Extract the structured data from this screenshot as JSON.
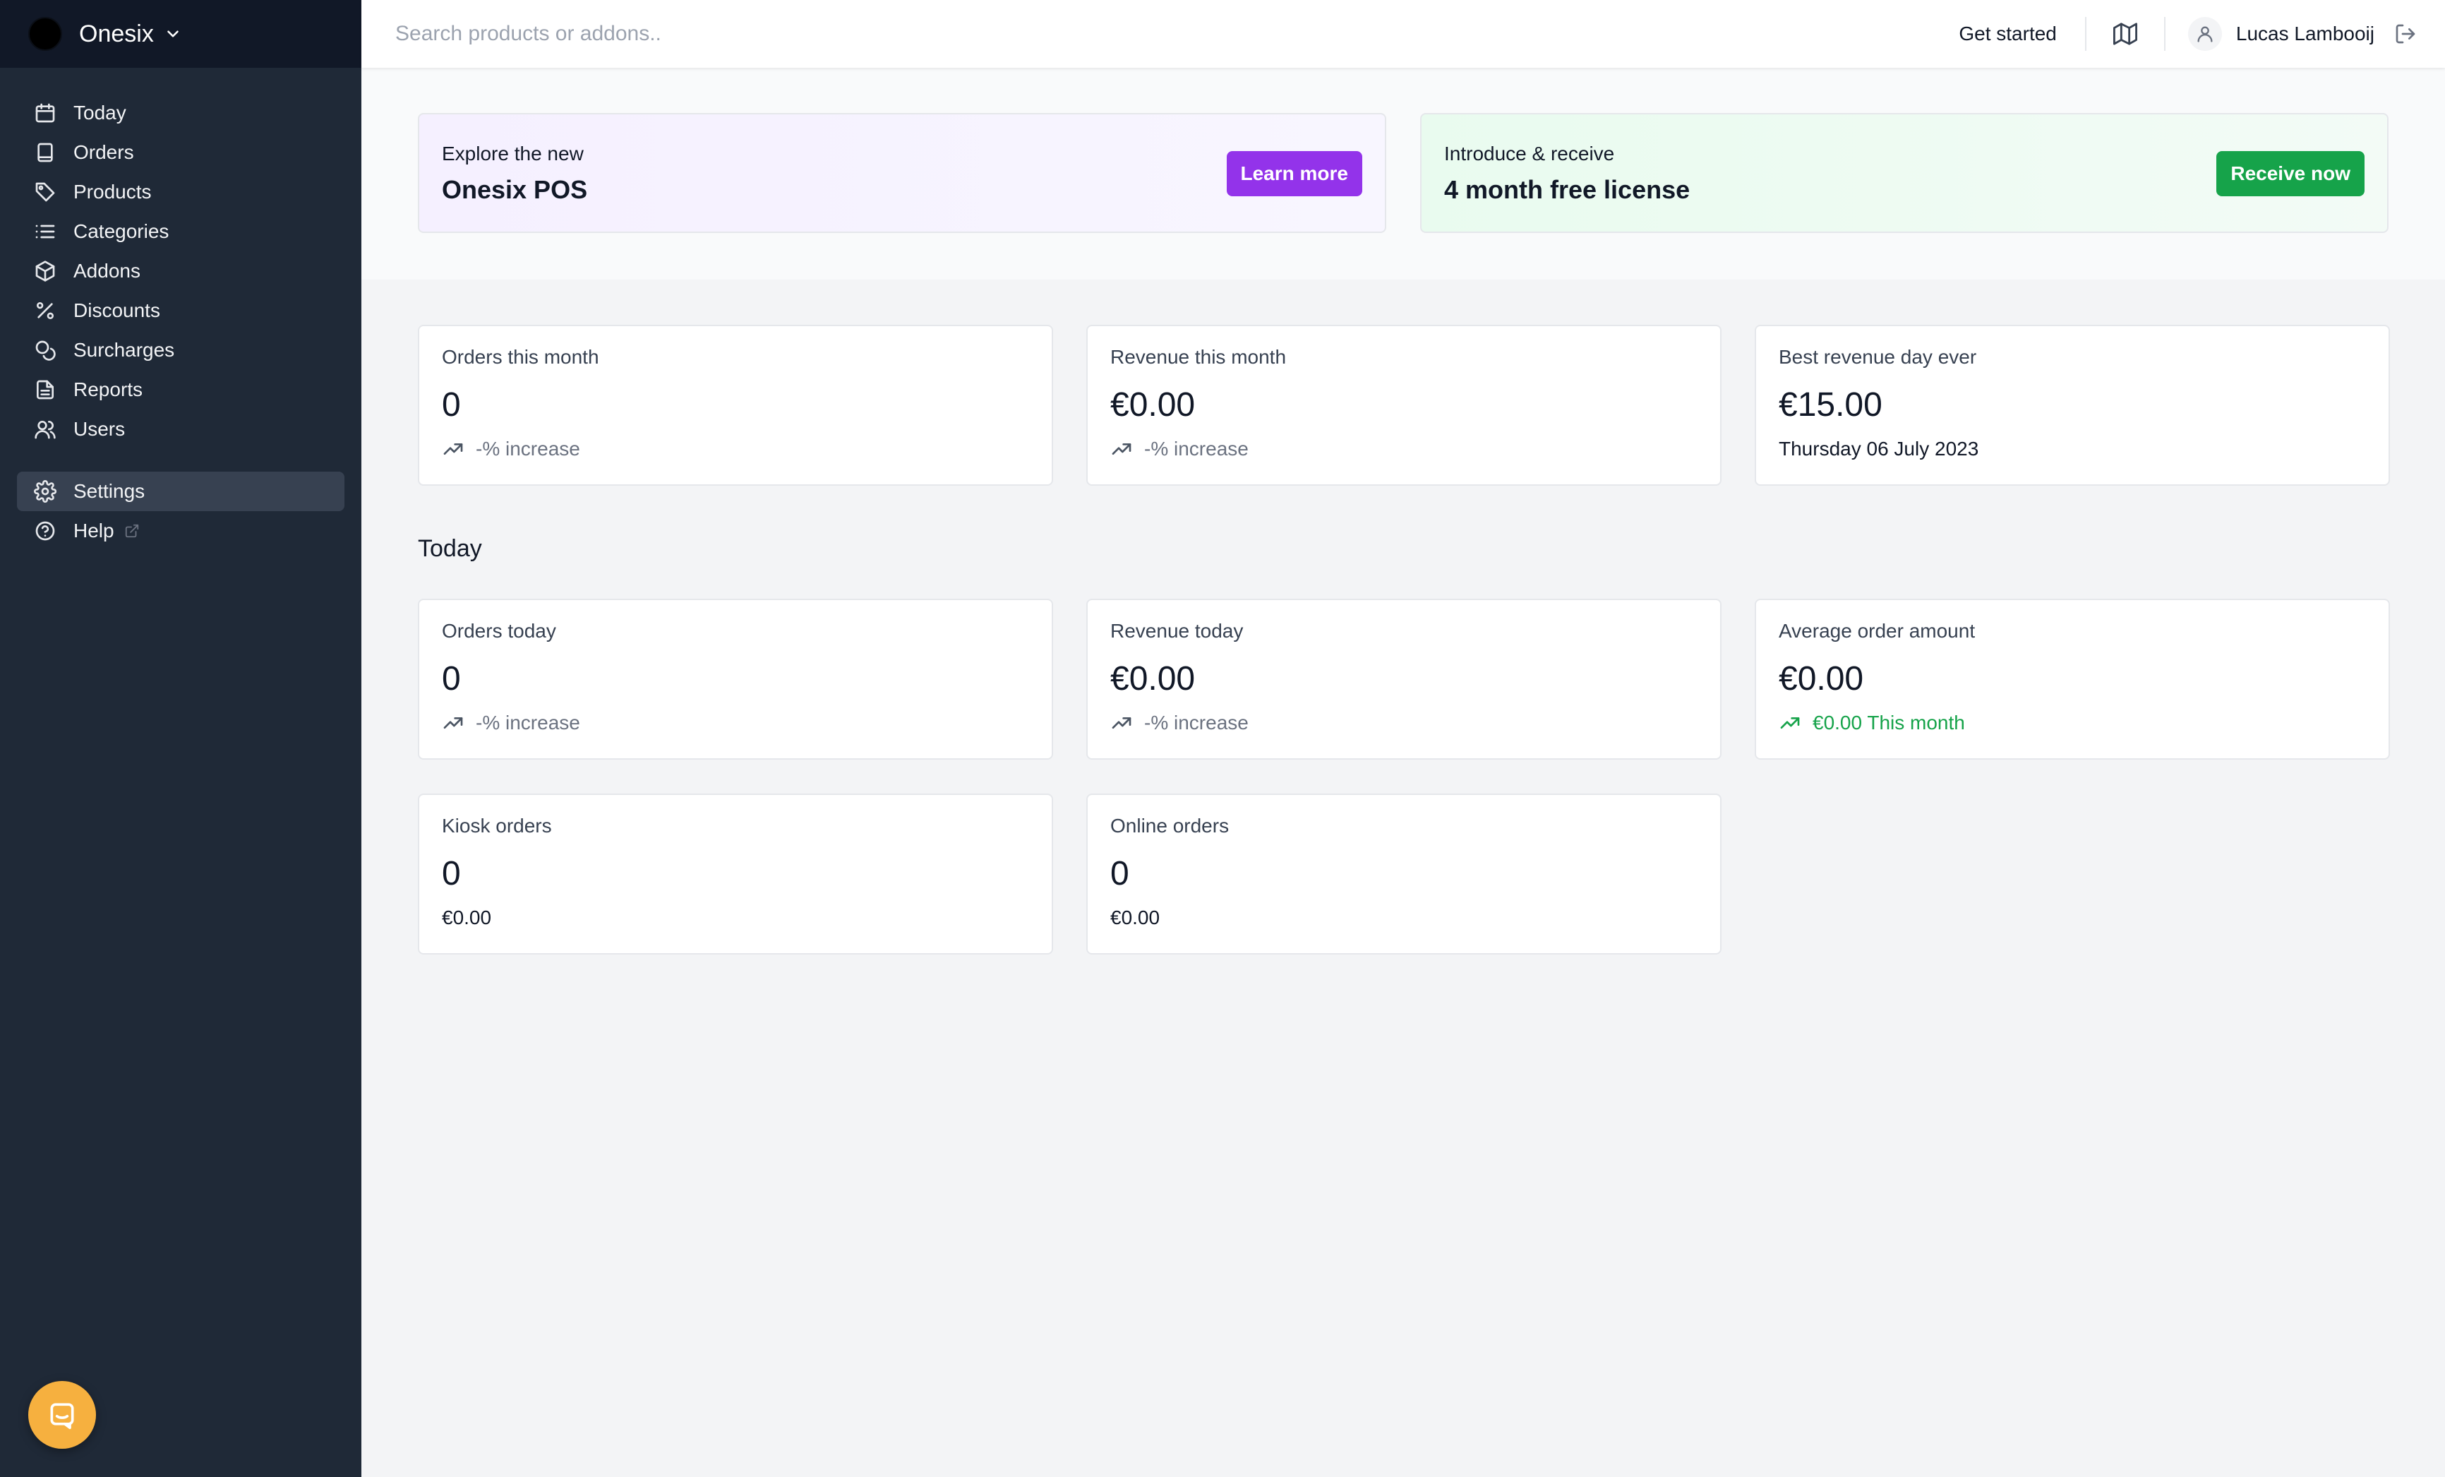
{
  "sidebar": {
    "brand": "Onesix",
    "items": [
      {
        "label": "Today",
        "icon": "calendar-icon"
      },
      {
        "label": "Orders",
        "icon": "receipt-icon"
      },
      {
        "label": "Products",
        "icon": "tag-icon"
      },
      {
        "label": "Categories",
        "icon": "list-icon"
      },
      {
        "label": "Addons",
        "icon": "cube-icon"
      },
      {
        "label": "Discounts",
        "icon": "percent-icon"
      },
      {
        "label": "Surcharges",
        "icon": "coins-icon"
      },
      {
        "label": "Reports",
        "icon": "document-icon"
      },
      {
        "label": "Users",
        "icon": "users-icon"
      }
    ],
    "settings": {
      "label": "Settings",
      "icon": "gear-icon",
      "active": true
    },
    "help": {
      "label": "Help",
      "icon": "help-circle-icon"
    }
  },
  "topbar": {
    "search_placeholder": "Search products or addons..",
    "get_started": "Get started",
    "user_name": "Lucas Lambooij"
  },
  "banners": {
    "pos": {
      "subtitle": "Explore the new",
      "title": "Onesix POS",
      "button": "Learn more",
      "color": "#9333ea"
    },
    "referral": {
      "subtitle": "Introduce & receive",
      "title": "4 month free license",
      "button": "Receive now",
      "color": "#16a34a"
    }
  },
  "month_stats": [
    {
      "label": "Orders this month",
      "value": "0",
      "foot": "-% increase"
    },
    {
      "label": "Revenue this month",
      "value": "€0.00",
      "foot": "-% increase"
    },
    {
      "label": "Best revenue day ever",
      "value": "€15.00",
      "foot": "Thursday 06 July 2023"
    }
  ],
  "today_section": {
    "title": "Today",
    "stats": [
      {
        "label": "Orders today",
        "value": "0",
        "foot": "-% increase"
      },
      {
        "label": "Revenue today",
        "value": "€0.00",
        "foot": "-% increase"
      },
      {
        "label": "Average order amount",
        "value": "€0.00",
        "foot": "€0.00 This month"
      },
      {
        "label": "Kiosk orders",
        "value": "0",
        "foot": "€0.00"
      },
      {
        "label": "Online orders",
        "value": "0",
        "foot": "€0.00"
      }
    ]
  },
  "colors": {
    "sidebar": "#1f2937",
    "brand_bar": "#111827",
    "accent_purple": "#9333ea",
    "accent_green": "#16a34a",
    "chat": "#f6b03f"
  }
}
